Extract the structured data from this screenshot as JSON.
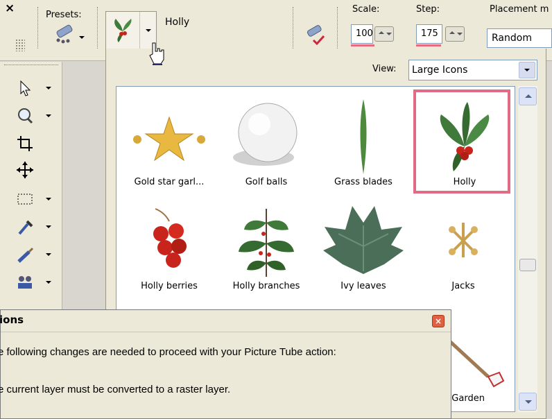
{
  "toolbar": {
    "close_glyph": "×",
    "presets_label": "Presets:",
    "tube_name": "Holly",
    "scale": {
      "label": "Scale:",
      "value": "100"
    },
    "step": {
      "label": "Step:",
      "value": "175"
    },
    "placement": {
      "label": "Placement m",
      "value": "Random"
    }
  },
  "flyout": {
    "view_label": "View:",
    "view_value": "Large Icons",
    "items": [
      {
        "label": "Gold star garl...",
        "icon": "gold-star-garland",
        "selected": false
      },
      {
        "label": "Golf balls",
        "icon": "golf-ball",
        "selected": false
      },
      {
        "label": "Grass blades",
        "icon": "grass-blade",
        "selected": false
      },
      {
        "label": "Holly",
        "icon": "holly",
        "selected": true
      },
      {
        "label": "Holly berries",
        "icon": "holly-berries",
        "selected": false
      },
      {
        "label": "Holly branches",
        "icon": "holly-branch",
        "selected": false
      },
      {
        "label": "Ivy leaves",
        "icon": "ivy-leaf",
        "selected": false
      },
      {
        "label": "Jacks",
        "icon": "jacks",
        "selected": false
      },
      {
        "label": "& Garden",
        "icon": "garden-tool",
        "selected": false
      }
    ]
  },
  "dialog": {
    "title": "ions",
    "line1": "e following changes are needed to proceed with your Picture Tube action:",
    "line2": "e current layer must be converted to a raster layer."
  },
  "colors": {
    "selection": "#e06b84",
    "toolbar_bg": "#ece9d8",
    "leaf": "#3f7a3a",
    "berry": "#c8241c"
  }
}
